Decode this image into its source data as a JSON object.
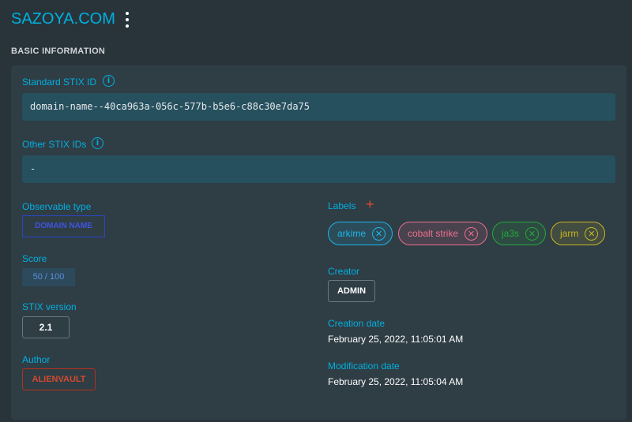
{
  "header": {
    "title": "SAZOYA.COM",
    "menu_icon": "more-vert-icon"
  },
  "section": {
    "title": "BASIC INFORMATION"
  },
  "standard_stix_id": {
    "label": "Standard STIX ID",
    "value": "domain-name--40ca963a-056c-577b-b5e6-c88c30e7da75"
  },
  "other_stix_ids": {
    "label": "Other STIX IDs",
    "value": "-"
  },
  "observable_type": {
    "label": "Observable type",
    "value": "DOMAIN NAME"
  },
  "score": {
    "label": "Score",
    "value": "50 / 100"
  },
  "stix_version": {
    "label": "STIX version",
    "value": "2.1"
  },
  "author": {
    "label": "Author",
    "value": "ALIENVAULT"
  },
  "labels": {
    "label": "Labels",
    "add_icon": "plus-icon",
    "items": [
      {
        "text": "arkime",
        "color": "#1fb6e8"
      },
      {
        "text": "cobalt strike",
        "color": "#ee6e8e"
      },
      {
        "text": "ja3s",
        "color": "#25a93a"
      },
      {
        "text": "jarm",
        "color": "#c7b624"
      }
    ]
  },
  "creator": {
    "label": "Creator",
    "value": "ADMIN"
  },
  "creation_date": {
    "label": "Creation date",
    "value": "February 25, 2022, 11:05:01 AM"
  },
  "modification_date": {
    "label": "Modification date",
    "value": "February 25, 2022, 11:05:04 AM"
  },
  "colors": {
    "accent": "#00b1e0",
    "background": "#28343a",
    "panel": "#2f3d45",
    "field": "#26505e"
  }
}
